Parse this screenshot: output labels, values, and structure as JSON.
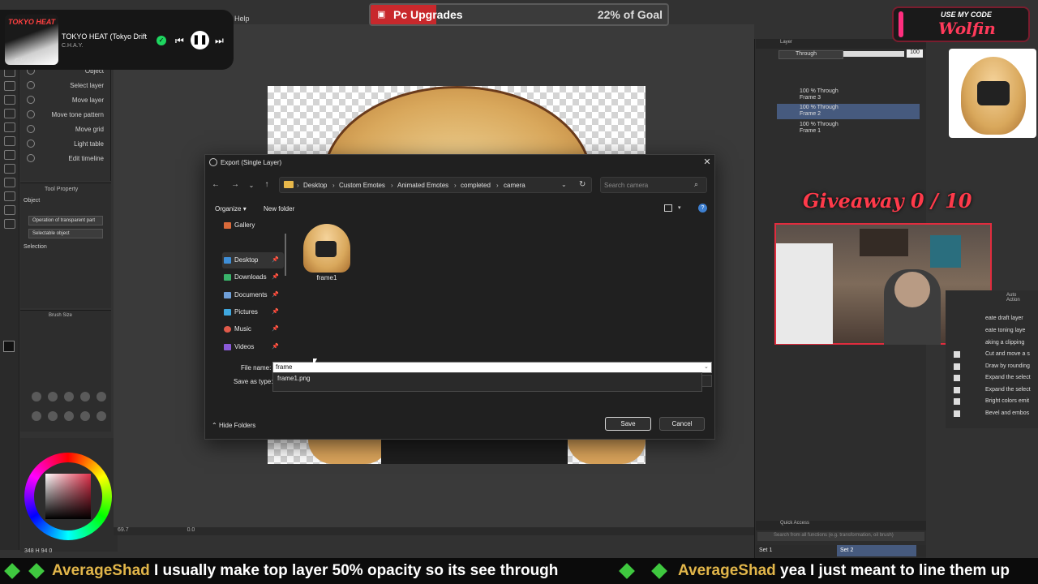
{
  "window": {
    "menu_help": "Help",
    "dialog_title": "Export (Single Layer)"
  },
  "music": {
    "album_text": "TOKYO HEAT",
    "album_subtext": "C.H.A.Y",
    "song": "TOKYO HEAT (Tokyo Drift",
    "artist": "C.H.A.Y."
  },
  "goal": {
    "title": "Pc Upgrades",
    "percent_label": "22% of Goal",
    "progress": 0.22
  },
  "code_badge": {
    "label": "USE MY CODE",
    "code": "Wolfin"
  },
  "sub_tools": [
    "Object",
    "Select layer",
    "Move layer",
    "Move tone pattern",
    "Move grid",
    "Light table",
    "Edit timeline"
  ],
  "tool_property": {
    "title": "Tool Property",
    "object_label": "Object",
    "operation": "Operation of transparent part",
    "selectable": "Selectable object",
    "selection_label": "Selection"
  },
  "brush_size": {
    "title": "Brush Size"
  },
  "address_bar": {
    "crumbs": [
      "Desktop",
      "Custom Emotes",
      "Animated Emotes",
      "completed",
      "camera"
    ],
    "search_placeholder": "Search camera"
  },
  "command_bar": {
    "organize": "Organize",
    "new_folder": "New folder"
  },
  "nav_pane": [
    {
      "label": "Gallery",
      "color": "#d96a3a",
      "pinned": false
    },
    {
      "label": "Desktop",
      "color": "#3f8fd8",
      "pinned": true,
      "selected": true
    },
    {
      "label": "Downloads",
      "color": "#39b36a",
      "pinned": true
    },
    {
      "label": "Documents",
      "color": "#6f9fd8",
      "pinned": true
    },
    {
      "label": "Pictures",
      "color": "#3fa8e0",
      "pinned": true
    },
    {
      "label": "Music",
      "color": "#e05a4a",
      "pinned": true
    },
    {
      "label": "Videos",
      "color": "#8a5ad8",
      "pinned": true
    }
  ],
  "pin_glyph": "📌",
  "files": [
    {
      "name": "frame1"
    }
  ],
  "form": {
    "file_name_label": "File name:",
    "file_name_value": "frame",
    "save_as_type_label": "Save as type:",
    "autocomplete": "frame1.png"
  },
  "footer": {
    "hide_folders": "Hide Folders",
    "save": "Save",
    "cancel": "Cancel"
  },
  "layers": {
    "header": "Layer",
    "blend_mode": "Through",
    "opacity": "100",
    "rows": [
      {
        "line1": "100 % Through",
        "line2": "Frame 3",
        "selected": false
      },
      {
        "line1": "100 % Through",
        "line2": "Frame 2",
        "selected": true
      },
      {
        "line1": "100 % Through",
        "line2": "Frame 1",
        "selected": false
      }
    ]
  },
  "giveaway": "Giveaway 0 / 10",
  "auto_action": {
    "title": "Auto Action",
    "items": [
      "eate draft layer",
      "eate toning laye",
      "aking a clipping",
      "Cut and move a s",
      "Draw by rounding",
      "Expand the select",
      "Expand the select",
      "Bright colors emit",
      "Bevel and embos"
    ]
  },
  "quick_access": {
    "title": "Quick Access",
    "search_placeholder": "Search from all functions (e.g. transformation, oil brush)",
    "set1": "Set 1",
    "set2": "Set 2"
  },
  "status": {
    "zoom": "69.7",
    "angle": "0.0",
    "color_values": "348 H 94 0"
  },
  "ticker": [
    {
      "user": "AverageShad",
      "message": "I usually make top layer 50% opacity so its see through"
    },
    {
      "user": "AverageShad",
      "message": "yea I just meant to line them up"
    }
  ],
  "colors": {
    "accent_red": "#e12c3e",
    "goal_fill": "#c8282c",
    "selection_blue": "#465a7e",
    "ticker_user": "#e2b64a"
  }
}
